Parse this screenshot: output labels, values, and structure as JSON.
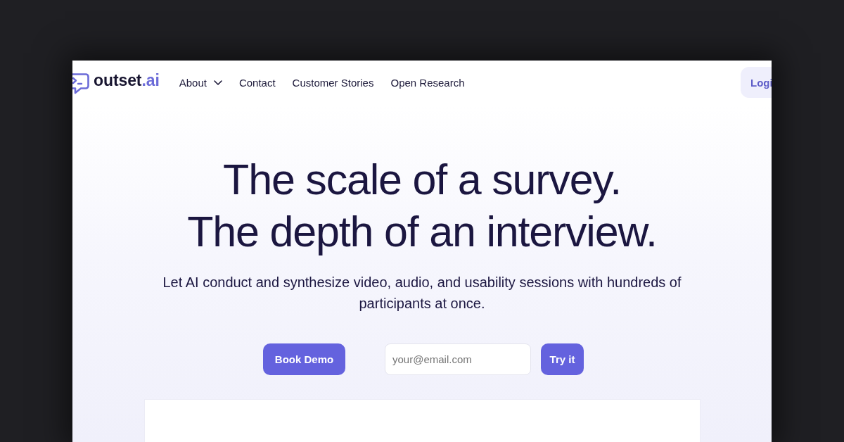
{
  "nav": {
    "logo": {
      "text": "outset",
      "accent": ".ai"
    },
    "items": [
      {
        "label": "About",
        "dropdown": true
      },
      {
        "label": "Contact",
        "dropdown": false
      },
      {
        "label": "Customer Stories",
        "dropdown": false
      },
      {
        "label": "Open Research",
        "dropdown": false
      }
    ],
    "login": {
      "label": "Logi"
    }
  },
  "hero": {
    "headline": [
      "The scale of a survey.",
      "The depth of an interview."
    ],
    "subtitle": "Let AI conduct and synthesize video, audio, and usability sessions with hundreds of participants at once.",
    "demo_button": {
      "label": "Book Demo"
    },
    "email": {
      "placeholder": "your@email.com"
    },
    "try_button": {
      "label": "Try it"
    }
  }
}
